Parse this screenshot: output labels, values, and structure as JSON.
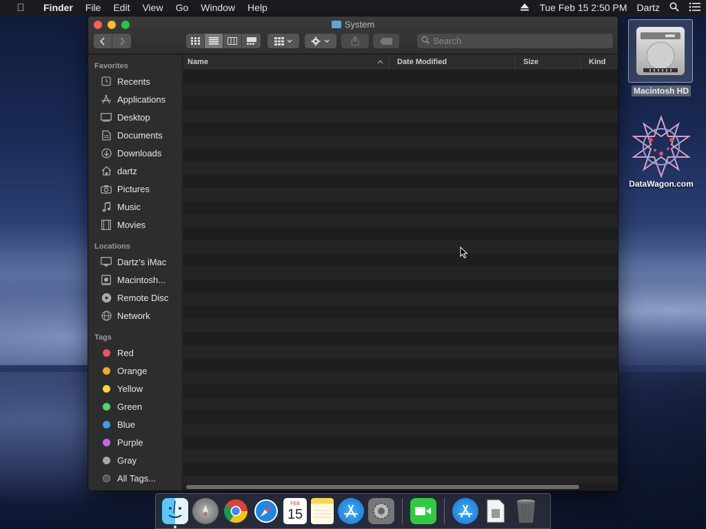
{
  "menubar": {
    "app": "Finder",
    "items": [
      "File",
      "Edit",
      "View",
      "Go",
      "Window",
      "Help"
    ],
    "datetime": "Tue Feb 15  2:50 PM",
    "user": "Dartz"
  },
  "desktop": {
    "drive_label": "Macintosh HD",
    "site_label": "DataWagon.com"
  },
  "window": {
    "title": "System",
    "search_placeholder": "Search"
  },
  "sidebar": {
    "favorites_header": "Favorites",
    "favorites": [
      {
        "label": "Recents",
        "icon": "clock-icon"
      },
      {
        "label": "Applications",
        "icon": "applications-icon"
      },
      {
        "label": "Desktop",
        "icon": "desktop-icon"
      },
      {
        "label": "Documents",
        "icon": "documents-icon"
      },
      {
        "label": "Downloads",
        "icon": "downloads-icon"
      },
      {
        "label": "dartz",
        "icon": "home-icon"
      },
      {
        "label": "Pictures",
        "icon": "camera-icon"
      },
      {
        "label": "Music",
        "icon": "music-note-icon"
      },
      {
        "label": "Movies",
        "icon": "film-icon"
      }
    ],
    "locations_header": "Locations",
    "locations": [
      {
        "label": "Dartz’s iMac",
        "icon": "imac-icon"
      },
      {
        "label": "Macintosh...",
        "icon": "hard-drive-icon"
      },
      {
        "label": "Remote Disc",
        "icon": "disc-icon"
      },
      {
        "label": "Network",
        "icon": "globe-icon"
      }
    ],
    "tags_header": "Tags",
    "tags": [
      {
        "label": "Red",
        "color": "#f0515a"
      },
      {
        "label": "Orange",
        "color": "#f5a623"
      },
      {
        "label": "Yellow",
        "color": "#f7d92b"
      },
      {
        "label": "Green",
        "color": "#4cd964"
      },
      {
        "label": "Blue",
        "color": "#3b9cf5"
      },
      {
        "label": "Purple",
        "color": "#c565e8"
      },
      {
        "label": "Gray",
        "color": "#a8a8a8"
      },
      {
        "label": "All Tags...",
        "color": "#555555"
      }
    ]
  },
  "filelist": {
    "columns": [
      "Name",
      "Date Modified",
      "Size",
      "Kind"
    ]
  },
  "dock": {
    "apps": [
      "finder-icon",
      "launchpad-icon",
      "chrome-icon",
      "safari-icon",
      "calendar-icon",
      "notes-icon",
      "app-store-icon",
      "system-preferences-icon",
      "facetime-icon",
      "app-store-folder-icon",
      "document-icon",
      "trash-icon"
    ],
    "calendar_month": "FEB",
    "calendar_day": "15"
  }
}
